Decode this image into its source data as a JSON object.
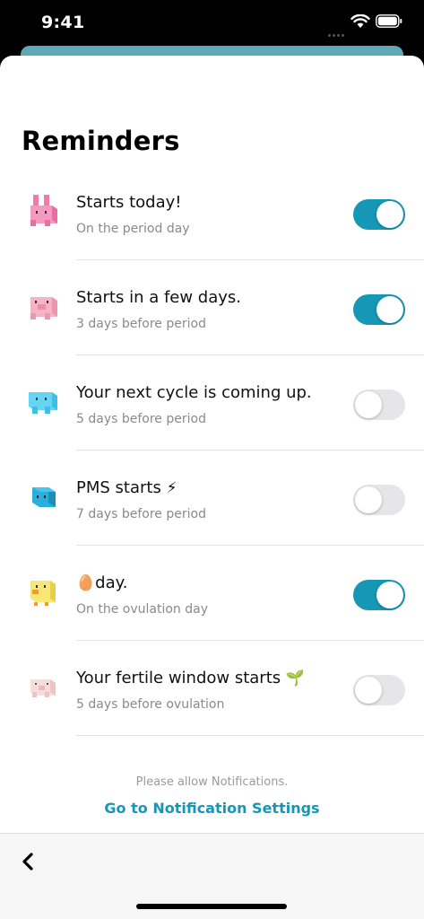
{
  "status_bar": {
    "time": "9:41"
  },
  "page": {
    "title": "Reminders"
  },
  "reminders": [
    {
      "title": "Starts today!",
      "title_emoji": "",
      "subtitle": "On the period day",
      "enabled": true,
      "mascot": "pink-bunny-mascot-icon",
      "color": "#f28cb8"
    },
    {
      "title": "Starts in a few days.",
      "title_emoji": "",
      "subtitle": "3 days before period",
      "enabled": true,
      "mascot": "pink-pig-mascot-icon",
      "color": "#f4a9c0"
    },
    {
      "title": "Your next cycle is coming up.",
      "title_emoji": "",
      "subtitle": "5 days before period",
      "enabled": false,
      "mascot": "light-blue-creature-mascot-icon",
      "color": "#5fd0ef"
    },
    {
      "title": "PMS starts",
      "title_emoji": "⚡",
      "subtitle": "7 days before period",
      "enabled": false,
      "mascot": "blue-cube-mascot-icon",
      "color": "#25a9d8"
    },
    {
      "title": "day.",
      "title_prefix_emoji": "🥚",
      "title_emoji": "",
      "subtitle": "On the ovulation day",
      "enabled": true,
      "mascot": "yellow-chick-mascot-icon",
      "color": "#f7e36a"
    },
    {
      "title": "Your fertile window starts",
      "title_emoji": "🌱",
      "subtitle": "5 days before ovulation",
      "enabled": false,
      "mascot": "light-pink-pig-mascot-icon",
      "color": "#f6d3d3"
    }
  ],
  "footer": {
    "notice": "Please allow Notifications.",
    "link": "Go to Notification Settings"
  },
  "colors": {
    "accent": "#1597b5",
    "toggle_off": "#e6e6e8"
  }
}
